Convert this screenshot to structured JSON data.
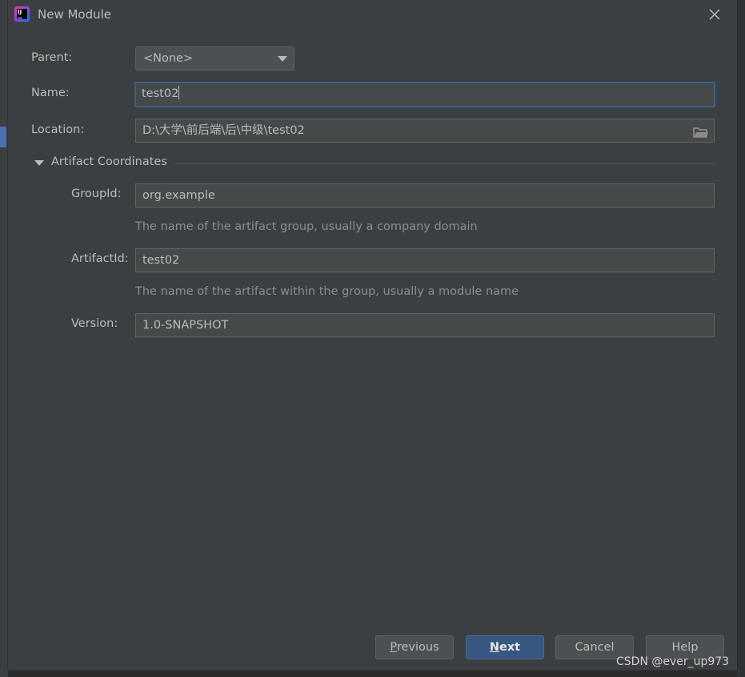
{
  "window": {
    "title": "New Module",
    "app_icon_text": "IJ"
  },
  "form": {
    "parent": {
      "label": "Parent:",
      "value": "<None>"
    },
    "name": {
      "label": "Name:",
      "value": "test02"
    },
    "location": {
      "label": "Location:",
      "value": "D:\\大学\\前后端\\后\\中级\\test02"
    }
  },
  "artifact": {
    "section_label": "Artifact Coordinates",
    "group_id": {
      "label": "GroupId:",
      "value": "org.example",
      "hint": "The name of the artifact group, usually a company domain"
    },
    "artifact_id": {
      "label": "ArtifactId:",
      "value": "test02",
      "hint": "The name of the artifact within the group, usually a module name"
    },
    "version": {
      "label": "Version:",
      "value": "1.0-SNAPSHOT"
    }
  },
  "buttons": {
    "previous": {
      "mnemonic": "P",
      "rest": "revious"
    },
    "next": {
      "mnemonic": "N",
      "rest": "ext"
    },
    "cancel": "Cancel",
    "help": "Help"
  },
  "watermark": "CSDN @ever_up973",
  "colors": {
    "dialog_bg": "#3c3f41",
    "field_bg": "#45494a",
    "focus_border": "#3d6185",
    "default_button": "#365880"
  }
}
